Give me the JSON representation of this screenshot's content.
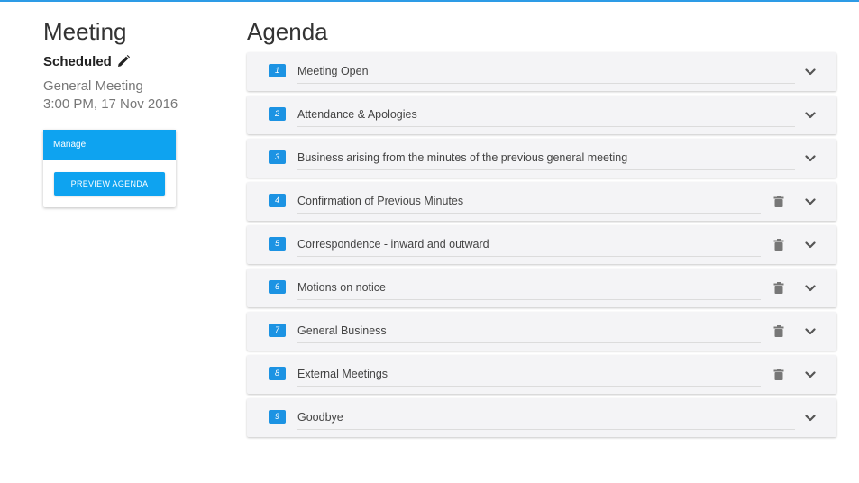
{
  "sidebar": {
    "title": "Meeting",
    "status": "Scheduled",
    "type": "General Meeting",
    "datetime": "3:00 PM, 17 Nov 2016",
    "manage_label": "Manage",
    "preview_button": "PREVIEW AGENDA"
  },
  "agenda": {
    "heading": "Agenda",
    "items": [
      {
        "number": "1",
        "title": "Meeting Open",
        "deletable": false
      },
      {
        "number": "2",
        "title": "Attendance & Apologies",
        "deletable": false
      },
      {
        "number": "3",
        "title": "Business arising from the minutes of the previous general meeting",
        "deletable": false
      },
      {
        "number": "4",
        "title": "Confirmation of Previous Minutes",
        "deletable": true
      },
      {
        "number": "5",
        "title": "Correspondence - inward and outward",
        "deletable": true
      },
      {
        "number": "6",
        "title": "Motions on notice",
        "deletable": true
      },
      {
        "number": "7",
        "title": "General Business",
        "deletable": true
      },
      {
        "number": "8",
        "title": "External Meetings",
        "deletable": true
      },
      {
        "number": "9",
        "title": "Goodbye",
        "deletable": false
      }
    ]
  },
  "icons": {
    "edit": "pencil-icon",
    "delete": "trash-icon",
    "expand": "chevron-down-icon"
  },
  "colors": {
    "accent": "#0ea3f0",
    "badge": "#1c93e3",
    "top_bar": "#2d9be6"
  }
}
